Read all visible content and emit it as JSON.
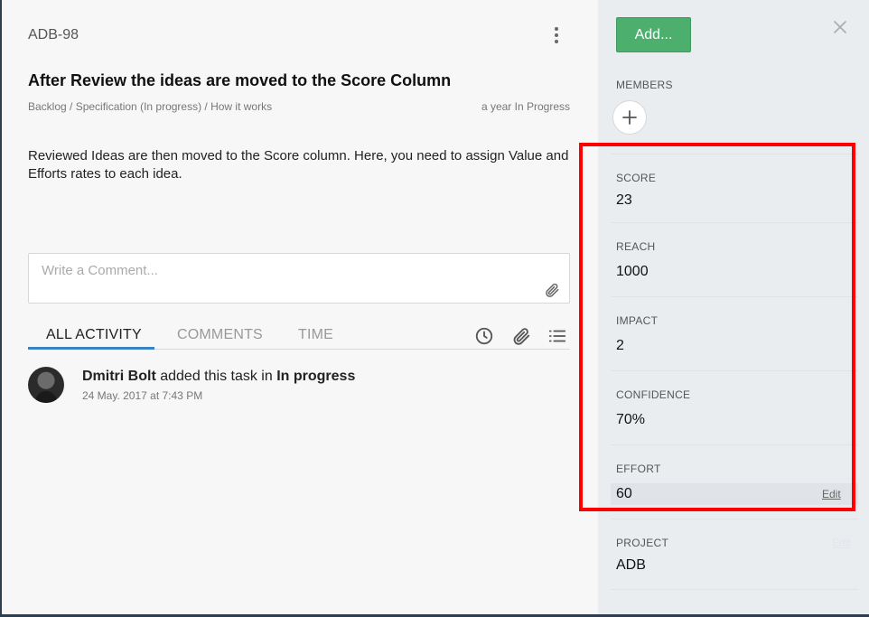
{
  "task": {
    "id": "ADB-98",
    "title": "After Review the ideas are moved to the Score Column",
    "breadcrumb": "Backlog / Specification (In progress) / How it works",
    "meta_status": "a year In Progress",
    "description": "Reviewed Ideas are then moved to the Score column. Here, you need to assign Value and Efforts rates to each idea."
  },
  "comment": {
    "placeholder": "Write a Comment...",
    "value": ""
  },
  "tabs": [
    {
      "label": "ALL ACTIVITY",
      "active": true
    },
    {
      "label": "COMMENTS",
      "active": false
    },
    {
      "label": "TIME",
      "active": false
    }
  ],
  "tab_icons": [
    "clock-icon",
    "paperclip-icon",
    "list-icon"
  ],
  "activity": [
    {
      "user": "Dmitri Bolt",
      "action": " added this task in ",
      "target": "In progress",
      "time": "24 May. 2017 at 7:43 PM"
    }
  ],
  "sidebar": {
    "add_label": "Add...",
    "members_label": "MEMBERS",
    "fields": [
      {
        "label": "SCORE",
        "value": "23"
      },
      {
        "label": "REACH",
        "value": "1000"
      },
      {
        "label": "IMPACT",
        "value": "2"
      },
      {
        "label": "CONFIDENCE",
        "value": "70%"
      },
      {
        "label": "EFFORT",
        "value": "60",
        "edit": "Edit"
      },
      {
        "label": "PROJECT",
        "value": "ADB",
        "edit": "Edit"
      }
    ]
  },
  "colors": {
    "accent_green": "#4caf6e",
    "tab_underline": "#3b82c4",
    "highlight": "#ff0000",
    "sidebar_bg": "#eaedf0"
  }
}
